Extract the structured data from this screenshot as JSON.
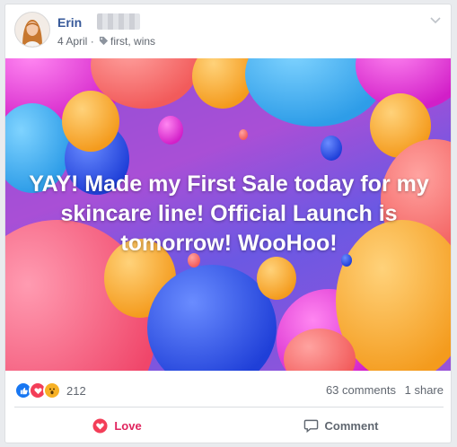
{
  "post": {
    "author": "Erin",
    "date": "4 April",
    "tags": "first, wins",
    "caption": "YAY! Made my First Sale today for my skincare line! Official Launch is tomorrow! WooHoo!"
  },
  "stats": {
    "reaction_count": "212",
    "comments": "63 comments",
    "shares": "1 share",
    "reactions": [
      "like-icon",
      "love-icon",
      "wow-icon"
    ]
  },
  "actions": {
    "love_label": "Love",
    "comment_label": "Comment"
  },
  "colors": {
    "name": "#365899",
    "love": "#e0245e",
    "like": "#1877f2",
    "wow": "#f7b125"
  }
}
